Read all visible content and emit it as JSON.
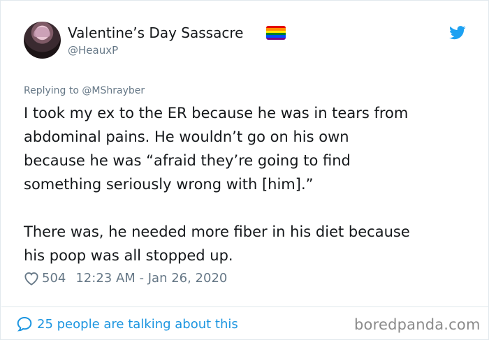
{
  "user": {
    "display_name": "Valentine’s Day Sassacre",
    "handle": "@HeauxP",
    "flag_icon": "rainbow-flag-icon",
    "flag_colors": [
      "#e40303",
      "#ff8c00",
      "#ffed00",
      "#008026",
      "#004dff",
      "#750787"
    ]
  },
  "brand": {
    "icon": "twitter-bird-icon",
    "color": "#1da1f2"
  },
  "reply": {
    "prefix": "Replying to ",
    "mention": "@MShrayber"
  },
  "tweet": {
    "lines": [
      "I took my ex to the ER because he was in tears from",
      "abdominal pains. He wouldn’t go on his own",
      "because he was “afraid they’re going to find",
      "something seriously wrong with [him].”",
      "There was, he needed more fiber in his diet because",
      "his poop was all stopped up."
    ]
  },
  "meta": {
    "likes": "504",
    "timestamp": "12:23 AM - Jan 26, 2020",
    "heart_icon": "heart-outline-icon"
  },
  "footer": {
    "talking_text": "25 people are talking about this",
    "talking_icon": "speech-bubble-icon",
    "link_color": "#1b95e0",
    "watermark": "boredpanda.com"
  }
}
